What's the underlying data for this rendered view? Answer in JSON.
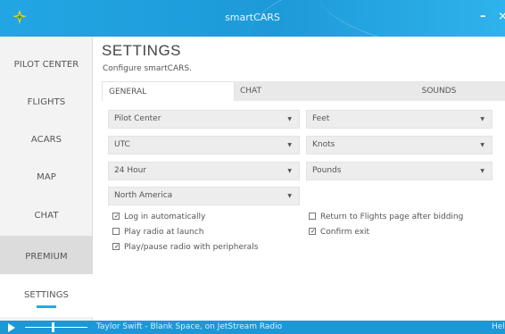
{
  "window": {
    "title": "smartCARS",
    "minimize_label": "–",
    "close_label": "×",
    "accent_color": "#22a6e3"
  },
  "sidebar": {
    "items": [
      {
        "label": "PILOT CENTER"
      },
      {
        "label": "FLIGHTS"
      },
      {
        "label": "ACARS"
      },
      {
        "label": "MAP"
      },
      {
        "label": "CHAT"
      },
      {
        "label": "PREMIUM"
      },
      {
        "label": "SETTINGS"
      }
    ],
    "active": "SETTINGS"
  },
  "page": {
    "title": "SETTINGS",
    "subtitle": "Configure smartCARS."
  },
  "tabs": [
    {
      "label": "GENERAL"
    },
    {
      "label": "CHAT"
    },
    {
      "label": "SOUNDS"
    }
  ],
  "general": {
    "selects": {
      "startup_page": "Pilot Center",
      "altitude_unit": "Feet",
      "time_zone": "UTC",
      "speed_unit": "Knots",
      "time_format": "24 Hour",
      "weight_unit": "Pounds",
      "region": "North America"
    },
    "dropdown_arrow": "▼",
    "checkboxes": {
      "log_in_automatically": {
        "label": "Log in automatically",
        "checked": true
      },
      "play_radio_at_launch": {
        "label": "Play radio at launch",
        "checked": false
      },
      "play_pause_radio_peripherals": {
        "label": "Play/pause radio with peripherals",
        "checked": true
      },
      "return_to_flights": {
        "label": "Return to Flights page after bidding",
        "checked": false
      },
      "confirm_exit": {
        "label": "Confirm exit",
        "checked": true
      }
    },
    "check_mark": "✓"
  },
  "statusbar": {
    "now_playing": "Taylor Swift - Blank Space, on JetStream Radio",
    "help_label": "Hel",
    "volume": 0.43
  }
}
